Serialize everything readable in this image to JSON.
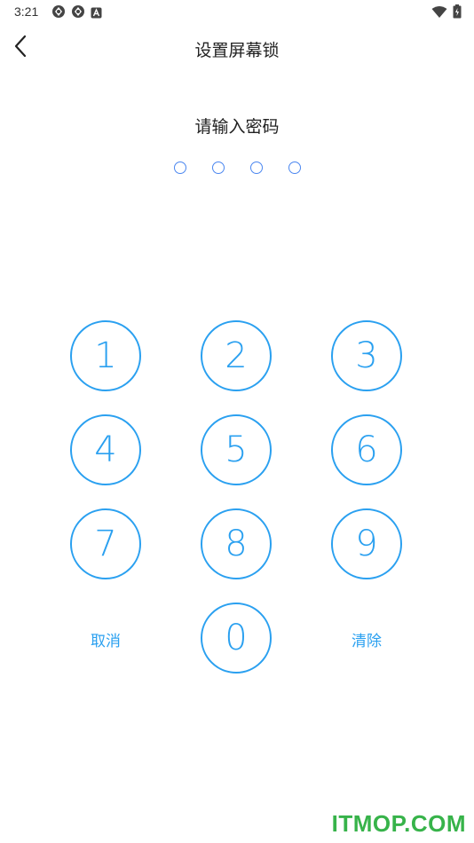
{
  "status_bar": {
    "time": "3:21",
    "icons_left": [
      "aperture-icon",
      "aperture-icon",
      "a-badge-icon"
    ],
    "icons_right": [
      "wifi-icon",
      "battery-charging-icon"
    ]
  },
  "header": {
    "title": "设置屏幕锁",
    "back_icon": "chevron-left-icon"
  },
  "prompt": {
    "text": "请输入密码"
  },
  "pin": {
    "length": 4,
    "filled": 0
  },
  "keypad": {
    "keys": [
      "1",
      "2",
      "3",
      "4",
      "5",
      "6",
      "7",
      "8",
      "9",
      "0"
    ],
    "cancel_label": "取消",
    "clear_label": "清除"
  },
  "watermark": {
    "text": "ITMOP.COM"
  },
  "colors": {
    "accent": "#2aa0f0",
    "dot": "#4a86f0",
    "watermark": "#37b34a"
  }
}
